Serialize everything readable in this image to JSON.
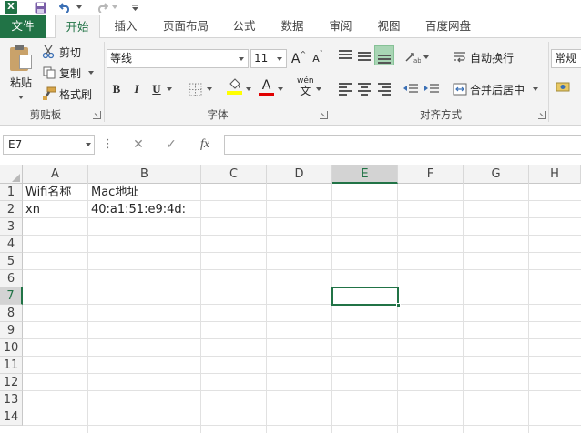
{
  "app": {
    "logo_letter": "X"
  },
  "tabs": [
    {
      "id": "file",
      "label": "文件"
    },
    {
      "id": "home",
      "label": "开始"
    },
    {
      "id": "insert",
      "label": "插入"
    },
    {
      "id": "layout",
      "label": "页面布局"
    },
    {
      "id": "formulas",
      "label": "公式"
    },
    {
      "id": "data",
      "label": "数据"
    },
    {
      "id": "review",
      "label": "审阅"
    },
    {
      "id": "view",
      "label": "视图"
    },
    {
      "id": "baidu",
      "label": "百度网盘"
    }
  ],
  "clipboard": {
    "paste_label": "粘贴",
    "cut_label": "剪切",
    "copy_label": "复制",
    "format_painter_label": "格式刷",
    "group_label": "剪贴板"
  },
  "font": {
    "font_name": "等线",
    "font_size": "11",
    "bold": "B",
    "italic": "I",
    "underline": "U",
    "phonetic_top": "wén",
    "phonetic_bottom": "文",
    "grow": "A",
    "shrink": "A",
    "font_color_letter": "A",
    "group_label": "字体",
    "fill_color": "#ffff00",
    "font_color": "#e00000"
  },
  "alignment": {
    "wrap_label": "自动换行",
    "merge_label": "合并后居中",
    "group_label": "对齐方式"
  },
  "number": {
    "format_value": "常规"
  },
  "formula_bar": {
    "name_box": "E7",
    "fx": "fx",
    "cancel": "✕",
    "enter": "✓",
    "formula": ""
  },
  "sheet": {
    "columns": [
      "A",
      "B",
      "C",
      "D",
      "E",
      "F",
      "G",
      "H"
    ],
    "rows": [
      "1",
      "2",
      "3",
      "4",
      "5",
      "6",
      "7",
      "8",
      "9",
      "10",
      "11",
      "12",
      "13",
      "14"
    ],
    "selected_column": "E",
    "selected_row": "7",
    "cells": {
      "A1": "Wifi名称",
      "B1": "Mac地址",
      "A2": "xn",
      "B2": "40:a1:51:e9:4d:"
    }
  }
}
